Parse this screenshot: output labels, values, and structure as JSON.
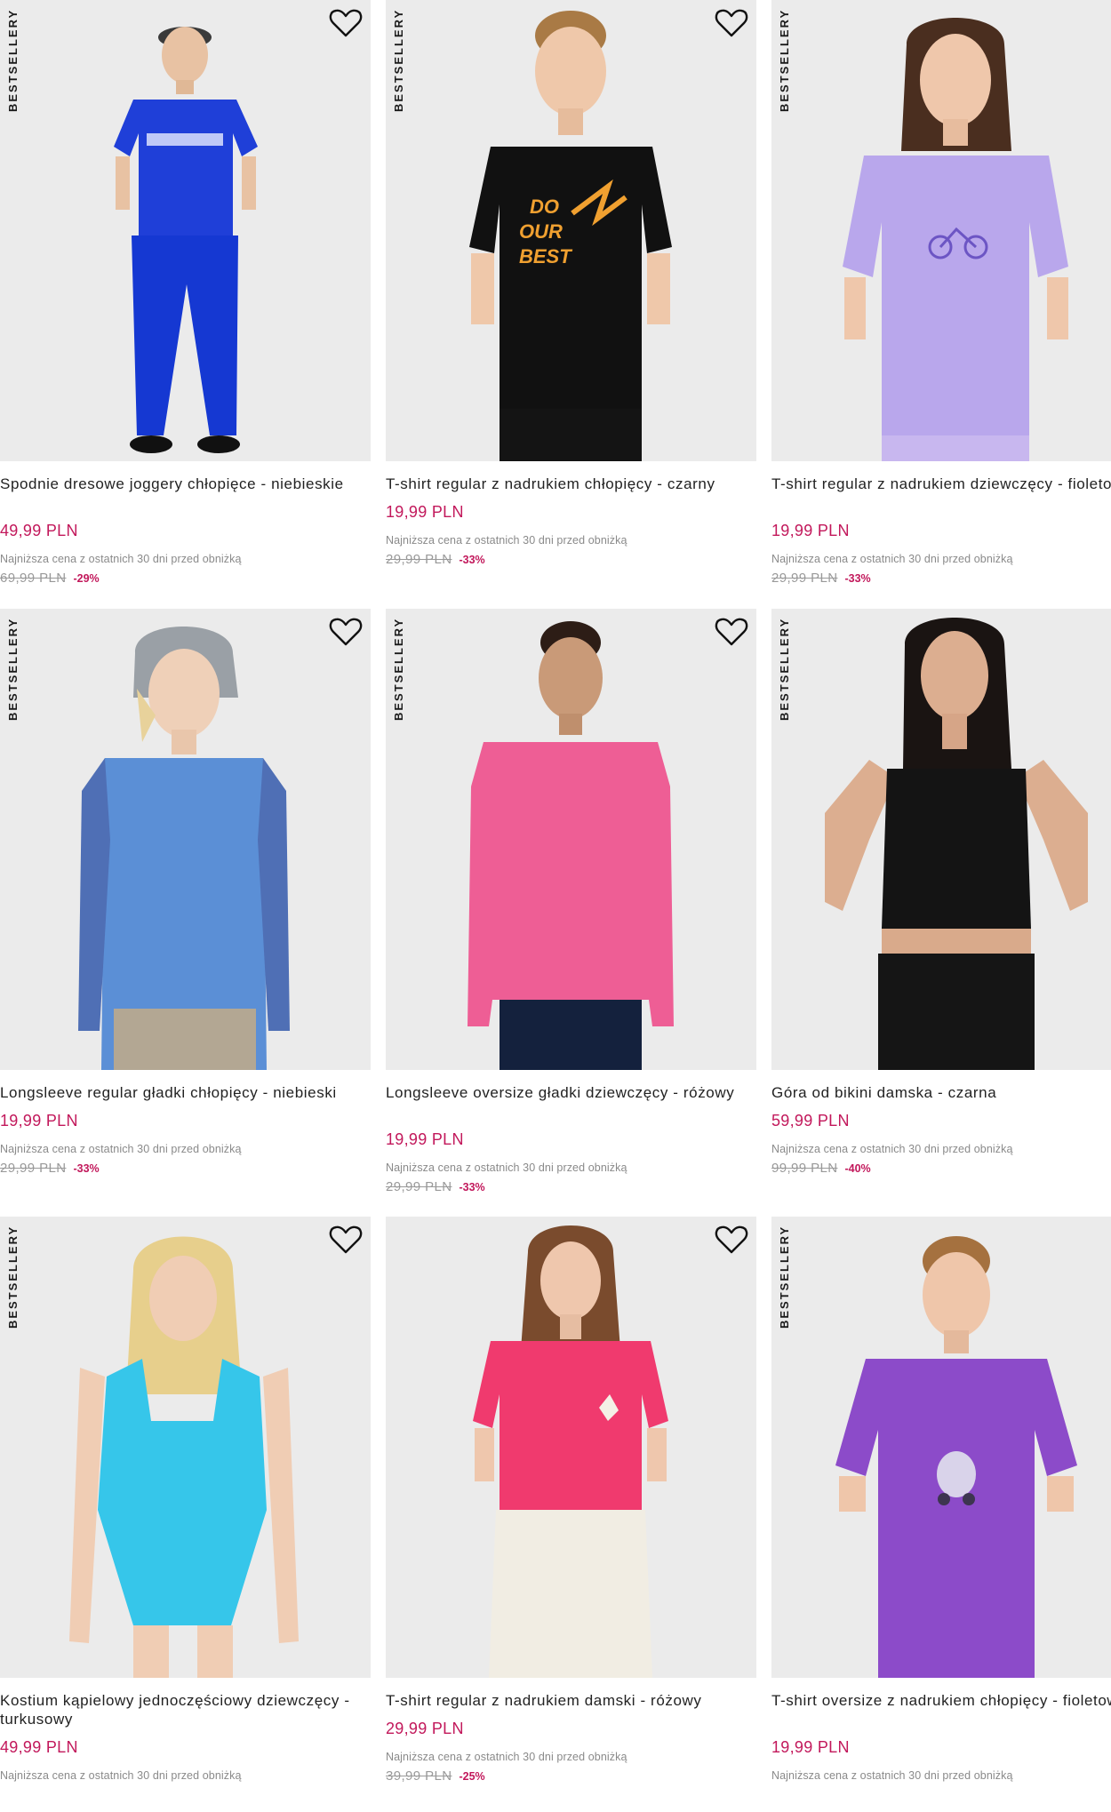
{
  "badge_label": "BESTSELLERY",
  "colors": {
    "price": "#c2185b",
    "discount": "#c2185b",
    "image_bg": "#ebebeb"
  },
  "products": [
    {
      "name": "Spodnie dresowe joggery chłopięce - niebieskie",
      "price": "49,99 PLN",
      "lowest_note": "Najniższa cena z ostatnich 30 dni przed obniżką",
      "old_price": "69,99 PLN",
      "discount": "-29%",
      "illustration": "boy-blue-tracksuit"
    },
    {
      "name": "T-shirt regular z nadrukiem chłopięcy - czarny",
      "price": "19,99 PLN",
      "lowest_note": "Najniższa cena z ostatnich 30 dni przed obniżką",
      "old_price": "29,99 PLN",
      "discount": "-33%",
      "illustration": "boy-black-tshirt"
    },
    {
      "name": "T-shirt regular z nadrukiem dziewczęcy - fioletowy",
      "price": "19,99 PLN",
      "lowest_note": "Najniższa cena z ostatnich 30 dni przed obniżką",
      "old_price": "29,99 PLN",
      "discount": "-33%",
      "illustration": "girl-lilac-tshirt"
    },
    {
      "name": "Longsleeve regular gładki chłopięcy - niebieski",
      "price": "19,99 PLN",
      "lowest_note": "Najniższa cena z ostatnich 30 dni przed obniżką",
      "old_price": "29,99 PLN",
      "discount": "-33%",
      "illustration": "boy-blue-longsleeve"
    },
    {
      "name": "Longsleeve oversize gładki dziewczęcy - różowy",
      "price": "19,99 PLN",
      "lowest_note": "Najniższa cena z ostatnich 30 dni przed obniżką",
      "old_price": "29,99 PLN",
      "discount": "-33%",
      "illustration": "girl-pink-longsleeve"
    },
    {
      "name": "Góra od bikini damska - czarna",
      "price": "59,99 PLN",
      "lowest_note": "Najniższa cena z ostatnich 30 dni przed obniżką",
      "old_price": "99,99 PLN",
      "discount": "-40%",
      "illustration": "woman-black-bikini-top"
    },
    {
      "name": "Kostium kąpielowy jednoczęściowy dziewczęcy - turkusowy",
      "price": "49,99 PLN",
      "lowest_note": "Najniższa cena z ostatnich 30 dni przed obniżką",
      "old_price": "",
      "discount": "",
      "illustration": "girl-turquoise-swimsuit"
    },
    {
      "name": "T-shirt regular z nadrukiem damski - różowy",
      "price": "29,99 PLN",
      "lowest_note": "Najniższa cena z ostatnich 30 dni przed obniżką",
      "old_price": "39,99 PLN",
      "discount": "-25%",
      "illustration": "woman-pink-tshirt"
    },
    {
      "name": "T-shirt oversize z nadrukiem chłopięcy - fioletowy",
      "price": "19,99 PLN",
      "lowest_note": "Najniższa cena z ostatnich 30 dni przed obniżką",
      "old_price": "",
      "discount": "",
      "illustration": "boy-purple-tshirt"
    }
  ]
}
